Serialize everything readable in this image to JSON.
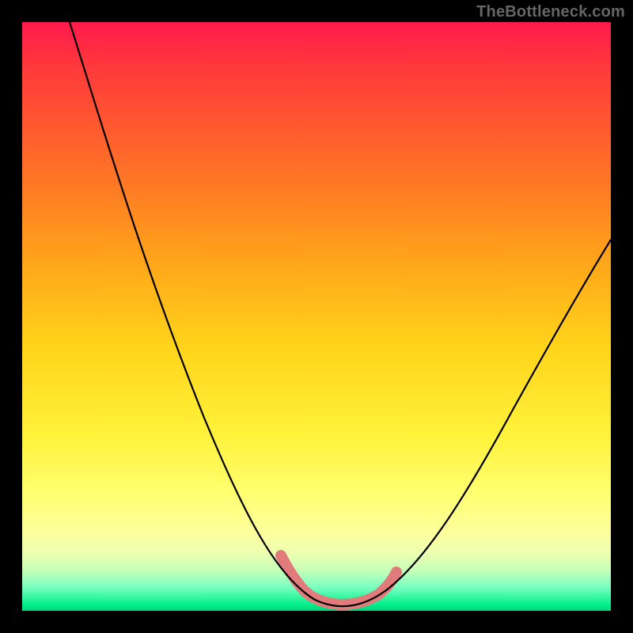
{
  "watermark": "TheBottleneck.com",
  "colors": {
    "frame_border": "#000000",
    "curve": "#000000",
    "highlight": "#e27c7c"
  },
  "chart_data": {
    "type": "line",
    "title": "",
    "xlabel": "",
    "ylabel": "",
    "xlim": [
      0,
      100
    ],
    "ylim": [
      0,
      100
    ],
    "x": [
      0,
      5,
      10,
      15,
      20,
      25,
      30,
      35,
      40,
      42,
      44,
      46,
      48,
      50,
      52,
      54,
      56,
      58,
      60,
      62,
      65,
      70,
      75,
      80,
      85,
      90,
      95,
      100
    ],
    "values": [
      100,
      89,
      78,
      67,
      56,
      45,
      35,
      25,
      16,
      12,
      9,
      6,
      4,
      2.5,
      1.5,
      1,
      1,
      1.5,
      2.5,
      4,
      7,
      14,
      22,
      30,
      38,
      46,
      53,
      60
    ],
    "highlight_range_x": [
      44,
      62
    ],
    "background_gradient": "vertical rainbow red→green maps to y (top=high, bottom=low)",
    "note": "x has no tick labels; y has no tick labels; values estimated from curve against gradient bands"
  }
}
